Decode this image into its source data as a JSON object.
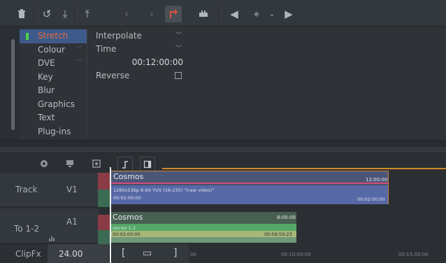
{
  "toolbar": {
    "icons": [
      "trash-icon",
      "undo-icon",
      "download-icon",
      "upload-icon",
      "arrow-left-icon",
      "arrow-right-icon",
      "trim-icon",
      "link-icon",
      "play-reverse-icon",
      "target-icon",
      "chevron-down-icon",
      "play-icon"
    ]
  },
  "effects": {
    "items": [
      {
        "label": "Stretch",
        "selected": true
      },
      {
        "label": "Colour",
        "has_menu": true
      },
      {
        "label": "DVE",
        "has_menu": true
      },
      {
        "label": "Key"
      },
      {
        "label": "Blur"
      },
      {
        "label": "Graphics"
      },
      {
        "label": "Text"
      },
      {
        "label": "Plug-ins"
      }
    ],
    "params": {
      "interpolate": "Interpolate",
      "time": "Time",
      "time_value": "00:12:00:00",
      "reverse": "Reverse"
    }
  },
  "timeline": {
    "tracks": {
      "v1_group": "Track",
      "v1": "V1",
      "a1_group": "To 1-2",
      "a1": "A1",
      "clipfx": "ClipFx",
      "clipfx_value": "24.00"
    },
    "video_clip": {
      "name": "Cosmos",
      "duration": "12:00:00",
      "format": "1280x536p 8-bit YUV (16-235) \"(raw video)\"",
      "tc_in": "00:02:00:00",
      "tc_out": "00:02:00:00"
    },
    "audio_clip": {
      "name": "Cosmos",
      "duration": "8:00:00",
      "channels": "stereo 1-2",
      "tc_in": "00:02:00:00",
      "tc_out": "00:09:59:23"
    },
    "ruler": {
      "t1": "00",
      "t2": "00:10:00:00",
      "t3": "00:15:00:00"
    },
    "footer_tools": [
      "[",
      "▭",
      "]"
    ]
  },
  "colors": {
    "selected_bg": "#3d5a8a",
    "selected_text": "#e06a3c",
    "clip_outline": "#c9853c",
    "video_clip": "#5668a6",
    "audio_green": "#53a865",
    "playhead": "#eef0f2"
  }
}
